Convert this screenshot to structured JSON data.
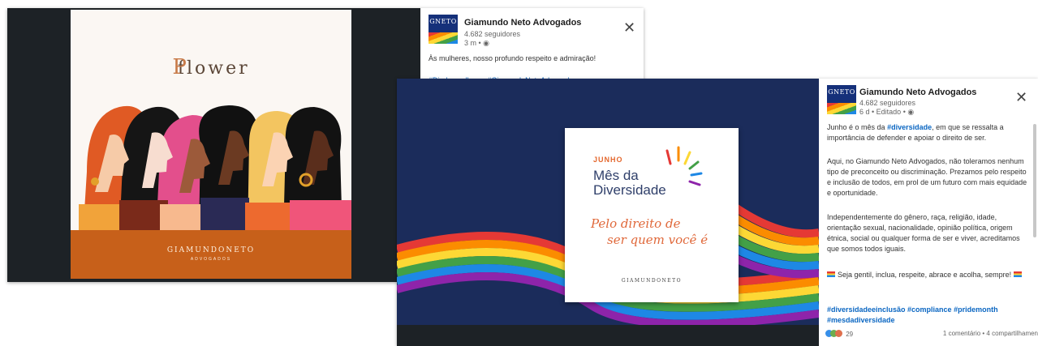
{
  "post1": {
    "image": {
      "brand_title": "flower",
      "brand_initial": "P",
      "footer_brand": "GIAMUNDONETO",
      "footer_sub": "ADVOGADOS"
    },
    "header": {
      "logo_text": "GNETO",
      "name": "Giamundo Neto Advogados",
      "followers": "4.682 seguidores",
      "time": "3 m •"
    },
    "text": "Às mulheres, nosso profundo respeito e admiração!",
    "hashtags": "#Diadasmulheres #GiamundoNetoAdvogados"
  },
  "post2": {
    "image": {
      "month": "JUNHO",
      "title_line1": "Mês da",
      "title_line2": "Diversidade",
      "script_line1": "Pelo direito de",
      "script_line2": "ser quem você é",
      "footer_brand": "GIAMUNDONETO"
    },
    "header": {
      "logo_text": "GNETO",
      "name": "Giamundo Neto Advogados",
      "followers": "4.682 seguidores",
      "time": "6 d • Editado •"
    },
    "text": {
      "p1_pre": "Junho é o mês da ",
      "p1_tag": "#diversidade",
      "p1_post": ", em que se ressalta a importância de defender e apoiar o direito de ser.",
      "p2": "Aqui, no Giamundo Neto Advogados, não toleramos nenhum tipo de preconceito ou discriminação. Prezamos pelo respeito e inclusão de todos, em prol de um futuro com mais equidade e oportunidade.",
      "p3": "Independentemente do gênero, raça, religião, idade, orientação sexual, nacionalidade, opinião política, origem étnica, social ou qualquer forma de ser e viver, acreditamos que somos todos iguais.",
      "p4": "Seja gentil, inclua, respeite, abrace e acolha, sempre!",
      "hashtags": "#diversidadeeinclusão #compliance #pridemonth #mesdadiversidade"
    },
    "footer": {
      "reaction_count": "29",
      "stats": "1 comentário • 4 compartilhamen"
    }
  },
  "colors": {
    "linkedin_blue": "#0a66c2",
    "viewer_dark": "#1d2226",
    "poster_orange": "#c7601a",
    "pride_navy": "#1b2c5b"
  }
}
